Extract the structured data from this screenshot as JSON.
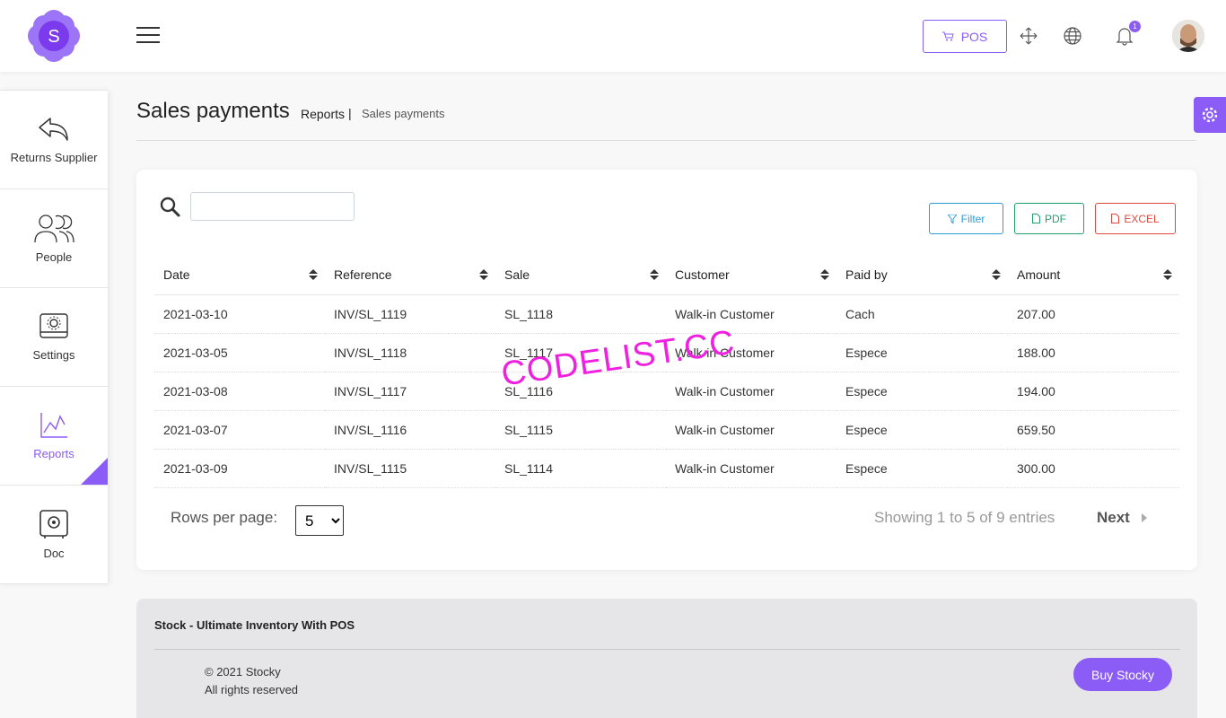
{
  "header": {
    "logo_letter": "S",
    "pos_label": "POS",
    "notification_count": "1"
  },
  "sidebar": {
    "items": [
      {
        "label": "Returns Supplier"
      },
      {
        "label": "People"
      },
      {
        "label": "Settings"
      },
      {
        "label": "Reports"
      },
      {
        "label": "Doc"
      }
    ],
    "active": "Reports"
  },
  "page": {
    "title": "Sales payments",
    "breadcrumb_parent": "Reports",
    "breadcrumb_sep": "|",
    "breadcrumb_current": "Sales payments"
  },
  "toolbar": {
    "search_value": "",
    "filter_label": "Filter",
    "pdf_label": "PDF",
    "excel_label": "EXCEL"
  },
  "table": {
    "columns": [
      "Date",
      "Reference",
      "Sale",
      "Customer",
      "Paid by",
      "Amount"
    ],
    "rows": [
      [
        "2021-03-10",
        "INV/SL_1119",
        "SL_1118",
        "Walk-in Customer",
        "Cach",
        "207.00"
      ],
      [
        "2021-03-05",
        "INV/SL_1118",
        "SL_1117",
        "Walk-in Customer",
        "Espece",
        "188.00"
      ],
      [
        "2021-03-08",
        "INV/SL_1117",
        "SL_1116",
        "Walk-in Customer",
        "Espece",
        "194.00"
      ],
      [
        "2021-03-07",
        "INV/SL_1116",
        "SL_1115",
        "Walk-in Customer",
        "Espece",
        "659.50"
      ],
      [
        "2021-03-09",
        "INV/SL_1115",
        "SL_1114",
        "Walk-in Customer",
        "Espece",
        "300.00"
      ]
    ]
  },
  "pagination": {
    "rows_per_page_label": "Rows per page:",
    "rows_per_page_value": "5",
    "showing_text": "Showing 1 to 5 of 9 entries",
    "next_label": "Next"
  },
  "footer": {
    "title": "Stock - Ultimate Inventory With POS",
    "copyright": "© 2021 Stocky",
    "rights": "All rights reserved",
    "buy_label": "Buy Stocky"
  },
  "watermark": "CODELIST.CC",
  "colors": {
    "accent": "#8b5cf6",
    "filter": "#2d9bd6",
    "pdf": "#22a06b",
    "excel": "#e0483e"
  }
}
